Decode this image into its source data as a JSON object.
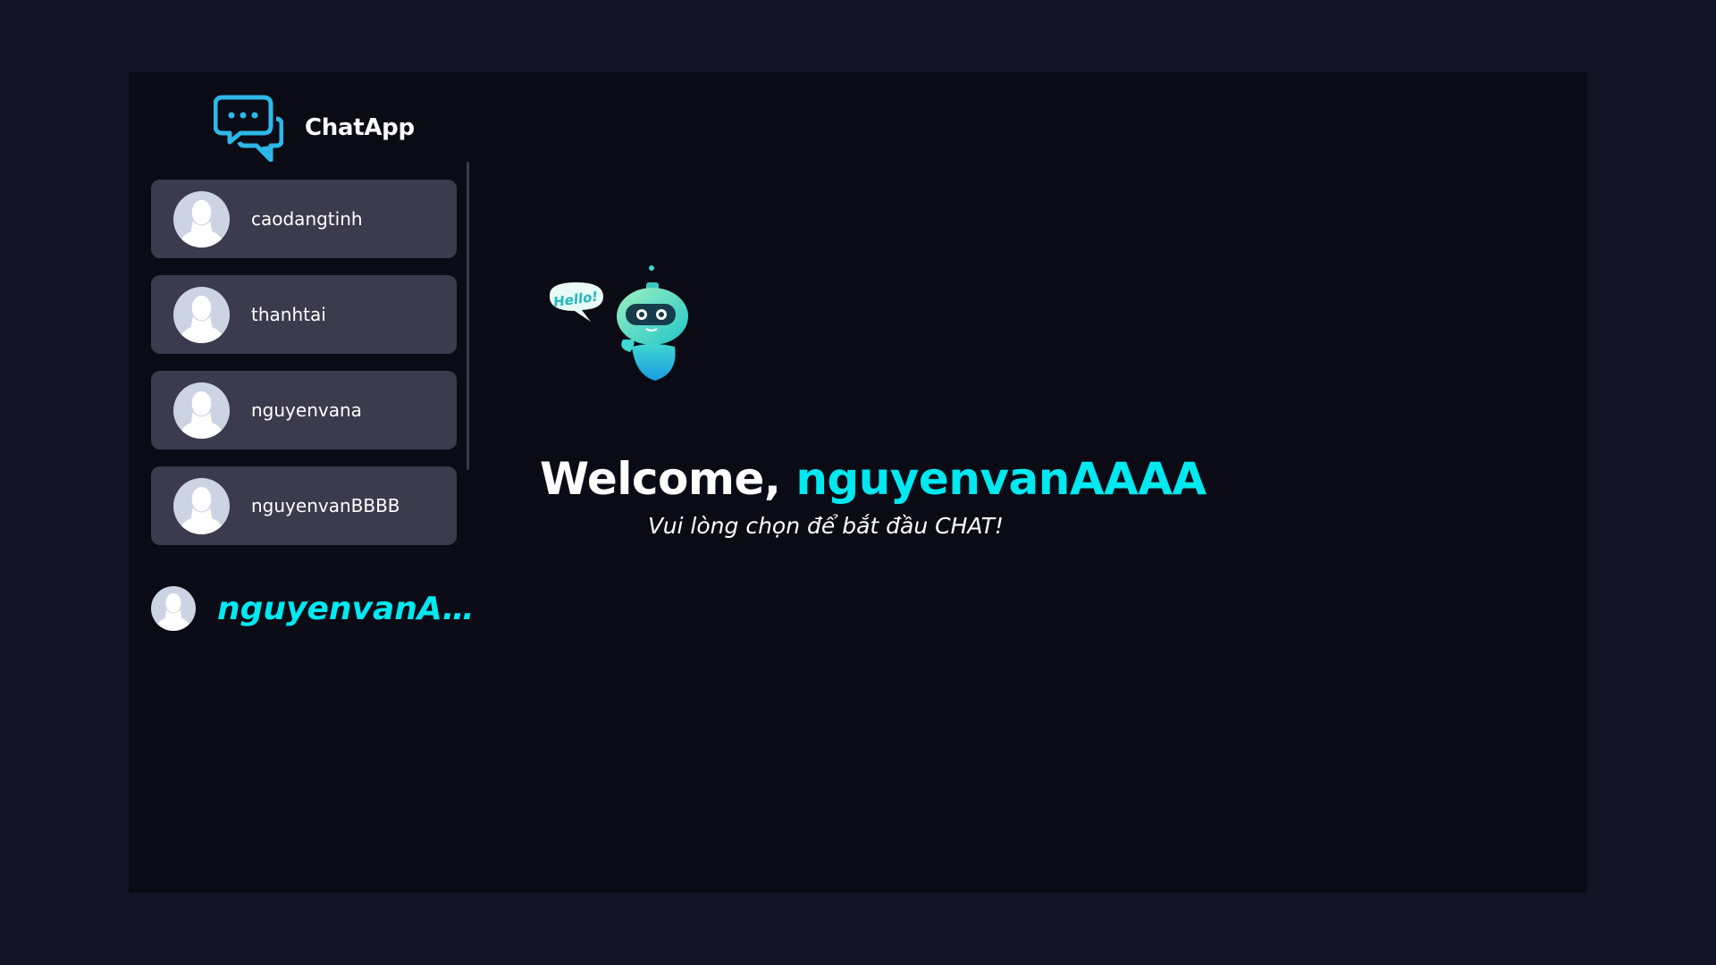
{
  "app": {
    "brand_name": "ChatApp"
  },
  "contacts": [
    {
      "name": "caodangtinh"
    },
    {
      "name": "thanhtai"
    },
    {
      "name": "nguyenvana"
    },
    {
      "name": "nguyenvanBBBB"
    }
  ],
  "current_user": {
    "name": "nguyenvanAAAA"
  },
  "welcome": {
    "greeting": "Welcome, ",
    "username": "nguyenvanAAAA",
    "subtitle": "Vui lòng chọn để bắt đầu CHAT!"
  },
  "illustration": {
    "speech_text": "Hello!"
  },
  "icons": {
    "logo": "chat-bubbles-icon",
    "avatar": "default-user-avatar-icon"
  },
  "colors": {
    "page_bg": "#131325",
    "panel_bg": "#0b0b16",
    "card_bg": "#3c3a4d",
    "accent": "#00e8f0",
    "logo": "#2cb8e6"
  }
}
